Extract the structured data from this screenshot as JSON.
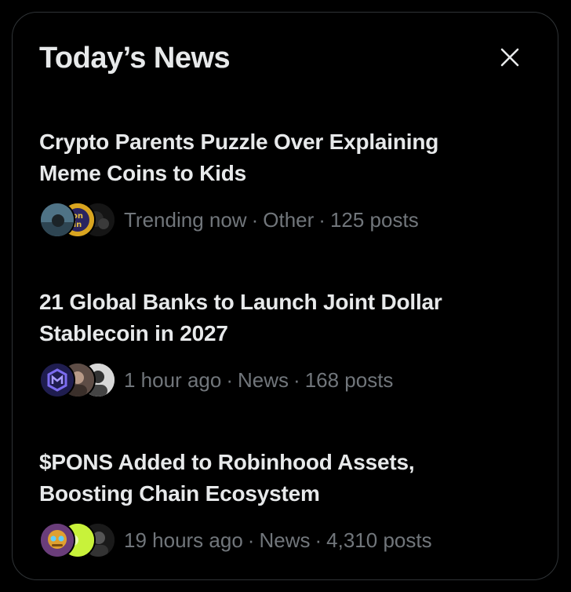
{
  "panel": {
    "title": "Today’s News",
    "close_icon": "close-icon"
  },
  "items": [
    {
      "title_line1": "Crypto Parents Puzzle Over Explaining",
      "title_line2": "Meme Coins to Kids",
      "time": "Trending now",
      "category": "Other",
      "posts": "125 posts"
    },
    {
      "title_line1": "21 Global Banks to Launch Joint Dollar",
      "title_line2": "Stablecoin in 2027",
      "time": "1 hour ago",
      "category": "News",
      "posts": "168 posts"
    },
    {
      "title_line1": "$PONS Added to Robinhood Assets,",
      "title_line2": "Boosting Chain Ecosystem",
      "time": "19 hours ago",
      "category": "News",
      "posts": "4,310 posts"
    }
  ],
  "colors": {
    "background": "#000000",
    "border": "#2f3336",
    "primary_text": "#e7e9ea",
    "secondary_text": "#71767b"
  }
}
